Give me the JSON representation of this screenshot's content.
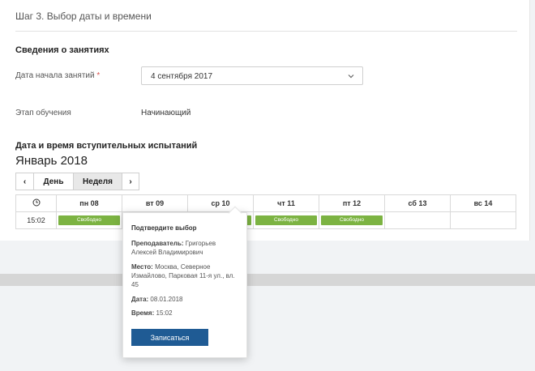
{
  "step": {
    "title": "Шаг 3. Выбор даты и времени"
  },
  "info": {
    "section_title": "Сведения о занятиях",
    "start_label": "Дата начала занятий",
    "required_mark": "*",
    "start_value": "4 сентября 2017",
    "stage_label": "Этап обучения",
    "stage_value": "Начинающий"
  },
  "exam": {
    "section_title": "Дата и время вступительных испытаний",
    "month": "Январь 2018",
    "prev": "‹",
    "next": "›",
    "day_btn": "День",
    "week_btn": "Неделя"
  },
  "calendar": {
    "clock_icon": "clock-icon",
    "days": [
      "пн 08",
      "вт 09",
      "ср 10",
      "чт 11",
      "пт 12",
      "сб 13",
      "вс 14"
    ],
    "time": "15:02",
    "slot_label": "Свободно"
  },
  "popup": {
    "title": "Подтвердите выбор",
    "teacher_label": "Преподаватель:",
    "teacher_value": "Григорьев Алексей Владимирович",
    "place_label": "Место:",
    "place_value": "Москва, Северное Измайлово, Парковая 11-я ул., вл. 45",
    "date_label": "Дата:",
    "date_value": "08.01.2018",
    "time_label": "Время:",
    "time_value": "15:02",
    "submit": "Записаться"
  },
  "colors": {
    "slot": "#7cb342",
    "button": "#1f5b94",
    "required": "#d9534f"
  }
}
